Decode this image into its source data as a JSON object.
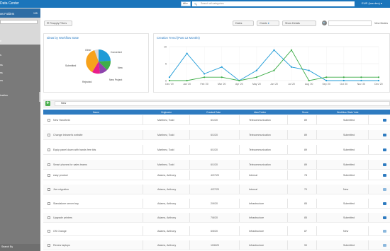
{
  "header": {
    "brand": "Data Center",
    "scope_select": "All",
    "search_placeholder": "Search all categories",
    "currency": "EUR (low dec)"
  },
  "sidebar": {
    "title": "ws Folders",
    "count": "105",
    "sections": [
      "n",
      "s",
      "ss",
      "ss",
      "ns",
      "ization"
    ],
    "footer_label": "Search By"
  },
  "toolbar": {
    "filters_button": "Reapply Filters",
    "tab_dates": "Dates",
    "tab_charts": "Charts",
    "tab_show_details": "Show Details",
    "view_mode": "View Modes"
  },
  "pie_panel": {
    "title": "Ideas by Workflow State",
    "colors": {
      "Converted": "#1f9bd7",
      "New": "#3fae49",
      "New Project": "#8e44ad",
      "Rejected": "#e91e8c",
      "Submitted": "#f7a21b",
      "Other": "#d9d9d9"
    },
    "labels": [
      "Other",
      "Converted",
      "Submitted",
      "New",
      "Rejected",
      "New Project"
    ]
  },
  "line_panel": {
    "title": "Creation Trend (Past 12 Months)"
  },
  "chart_data": {
    "type": "line",
    "title": "Creation Trend (Past 12 Months)",
    "categories": [
      "Dec '19",
      "Jan '20",
      "Feb '20",
      "Mar '20",
      "Apr '20",
      "May '20",
      "Jun '20",
      "Jul '20",
      "Aug '20",
      "Sep '20",
      "Oct '20",
      "Nov '20",
      "Dec '20"
    ],
    "series": [
      {
        "values": [
          1,
          8,
          2,
          4,
          0,
          3,
          9,
          4,
          3,
          0,
          0,
          0,
          0
        ],
        "color": "#1f9bd7"
      },
      {
        "values": [
          0,
          0,
          1,
          1,
          0,
          1,
          3,
          9,
          0,
          1,
          1,
          1,
          1
        ],
        "color": "#3fae49"
      }
    ],
    "ylim": [
      0,
      10
    ],
    "yticks": [
      0,
      5,
      10
    ],
    "grid": true
  },
  "table": {
    "new_filter": "New",
    "columns": [
      "Name",
      "Originator",
      "Created Date",
      "Idea Folder",
      "Score",
      "Workflow State Vote"
    ],
    "rows": [
      {
        "name": "New Handheld",
        "originator": "Martinez, Todd",
        "date": "6/1/20",
        "folder": "Telecommunication",
        "score": "89",
        "state": "Submitted"
      },
      {
        "name": "Change Intranet's website",
        "originator": "Martinez, Todd",
        "date": "6/1/20",
        "folder": "Telecommunication",
        "score": "89",
        "state": "Submitted"
      },
      {
        "name": "Equip panel down with hands free kits",
        "originator": "Martinez, Todd",
        "date": "6/1/20",
        "folder": "Telecommunication",
        "score": "89",
        "state": "Submitted"
      },
      {
        "name": "Smart phones for sales teams",
        "originator": "Martinez, Todd",
        "date": "6/1/20",
        "folder": "Telecommunication",
        "score": "89",
        "state": "Submitted"
      },
      {
        "name": "easy product",
        "originator": "Adams, Anthony",
        "date": "4/27/20",
        "folder": "Internal",
        "score": "78",
        "state": "Submitted"
      },
      {
        "name": "Jive migration",
        "originator": "Adams, Anthony",
        "date": "4/27/20",
        "folder": "Internal",
        "score": "70",
        "state": "New"
      },
      {
        "name": "Standalone server bay",
        "originator": "Adams, Anthony",
        "date": "2/9/20",
        "folder": "Infrastructure",
        "score": "85",
        "state": "Submitted"
      },
      {
        "name": "Upgrade printers",
        "originator": "Adams, Anthony",
        "date": "7/6/20",
        "folder": "Infrastructure",
        "score": "85",
        "state": "Submitted"
      },
      {
        "name": "OS Change",
        "originator": "Adams, Anthony",
        "date": "6/5/20",
        "folder": "Infrastructure",
        "score": "87",
        "state": "New"
      },
      {
        "name": "Renew laptops",
        "originator": "Adams, Anthony",
        "date": "10/6/20",
        "folder": "Infrastructure",
        "score": "90",
        "state": "Submitted"
      }
    ]
  }
}
